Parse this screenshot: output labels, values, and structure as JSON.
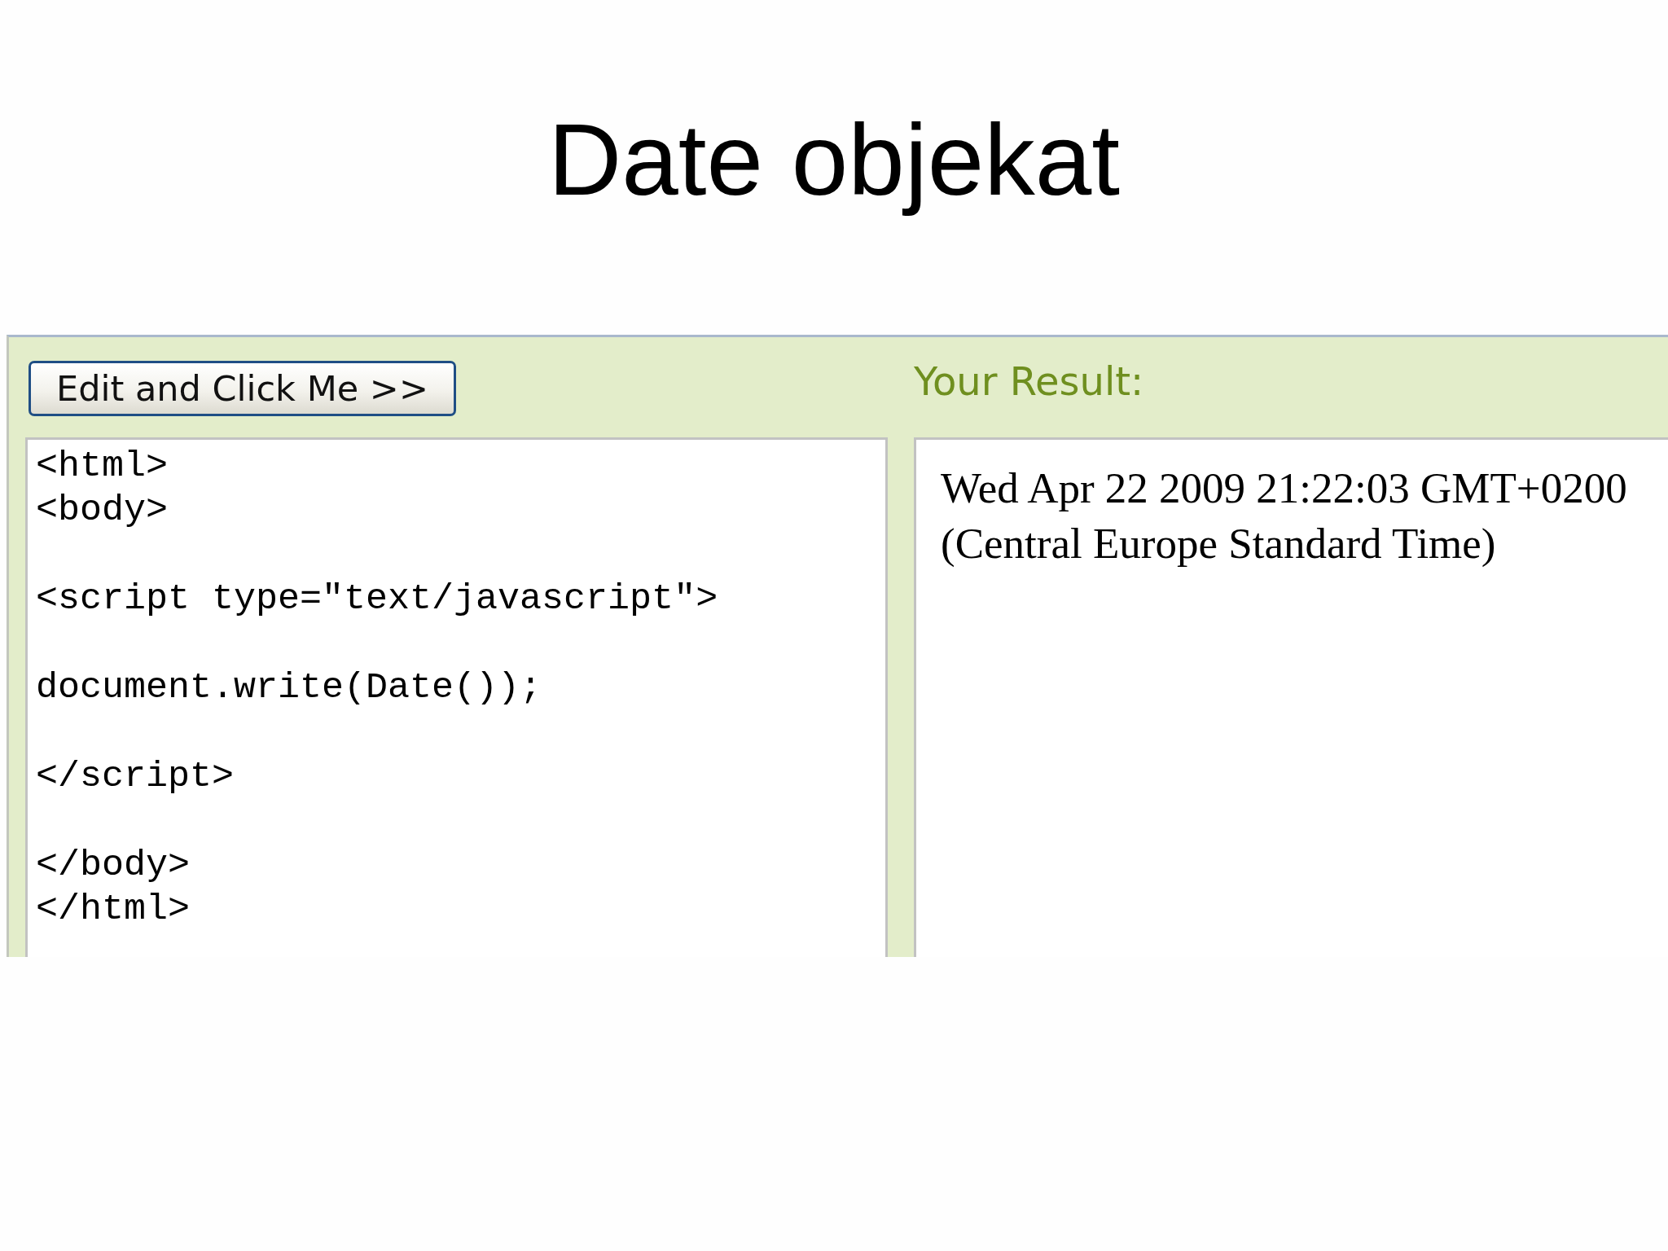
{
  "slide": {
    "title": "Date objekat"
  },
  "tryit": {
    "run_button": {
      "label": "Edit and Click Me >>"
    },
    "result_heading": "Your Result:",
    "code_editor": {
      "value": "<html>\n<body>\n\n<script type=\"text/javascript\">\n\ndocument.write(Date());\n\n</script>\n\n</body>\n</html>"
    },
    "result": {
      "text": "Wed Apr 22 2009 21:22:03 GMT+0200 (Central Europe Standard Time)"
    }
  }
}
